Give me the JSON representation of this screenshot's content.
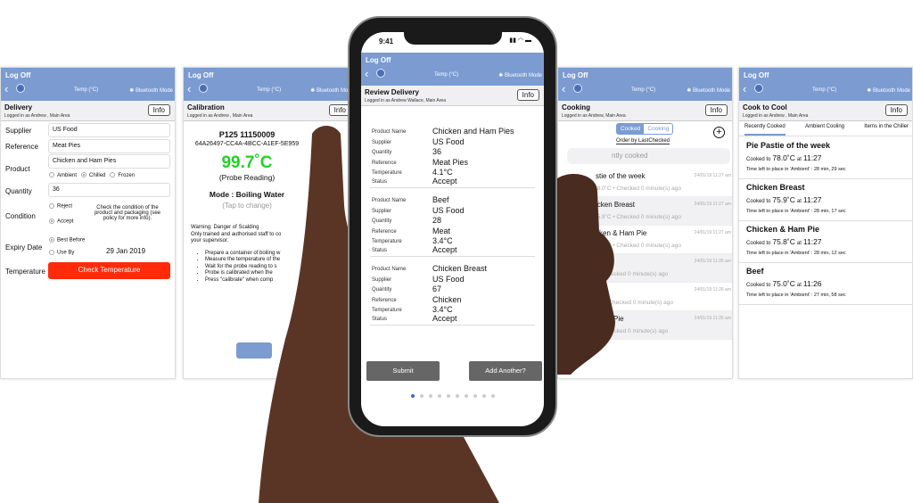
{
  "common": {
    "logoff": "Log Off",
    "back": "‹",
    "temp": "Temp (°C)",
    "bluetooth": "Bluetooth Mode",
    "bt_icon": "bluetooth-icon",
    "info": "Info"
  },
  "delivery": {
    "title": "Delivery",
    "logged": "Logged in as Andrew , Main Area",
    "supplier_label": "Supplier",
    "supplier": "US Food",
    "reference_label": "Reference",
    "reference": "Meat Pies",
    "product_label": "Product",
    "product": "Chicken and Ham Pies",
    "storage": [
      "Ambient",
      "Chilled",
      "Frozen"
    ],
    "storage_selected": "Chilled",
    "quantity_label": "Quantity",
    "quantity": "36",
    "condition_label": "Condition",
    "condition": [
      "Reject",
      "Accept"
    ],
    "condition_selected": "Accept",
    "condition_help": "Check the condition of the product and packaging (see policy for more info).",
    "expiry_label": "Expiry Date",
    "expiry": [
      "Best Before",
      "Use By"
    ],
    "expiry_selected": "Best Before",
    "expiry_date": "29 Jan 2019",
    "temperature_label": "Temperature",
    "check_temp": "Check Temperature",
    "check_color": "#ff2a0a"
  },
  "calibration": {
    "title": "Calibration",
    "logged": "Logged in as Andrew , Main Area",
    "probe": "P125 11150009",
    "uuid": "64A26497-CC4A-4BCC-A1EF-5E959",
    "reading": "99.7˚C",
    "reading_color": "#22d322",
    "reading_label": "(Probe Reading)",
    "mode": "Mode : Boiling Water",
    "tap": "(Tap to change)",
    "warning": [
      "Warning: Danger of Scalding",
      "Only trained and authorised staff to co",
      "your supervisor."
    ],
    "steps": [
      "Prepare a container of boiling w",
      "Measure the temperature of the",
      "Wait for the probe reading to s",
      "Probe is calibrated when the",
      "Press \"calibrate\" when comp"
    ]
  },
  "phone": {
    "time": "9:41",
    "title": "Review Delivery",
    "logged": "Logged in as Andrew Wallace, Main Area",
    "labels": [
      "Product Name",
      "Supplier",
      "Quantity",
      "Reference",
      "Temperature",
      "Status"
    ],
    "items": [
      [
        "Chicken and Ham Pies",
        "US Food",
        "36",
        "Meat Pies",
        "4.1°C",
        "Accept"
      ],
      [
        "Beef",
        "US Food",
        "28",
        "Meat",
        "3.4°C",
        "Accept"
      ],
      [
        "Chicken Breast",
        "US Food",
        "67",
        "Chicken",
        "3.4°C",
        "Accept"
      ]
    ],
    "submit": "Submit",
    "add_another": "Add Another?",
    "page_count": 10,
    "page_current": 1
  },
  "cooking": {
    "title": "Cooking",
    "logged": "Logged in as Andrew, Main Area",
    "seg": [
      "Cooked",
      "Cooking"
    ],
    "seg_selected": "Cooked",
    "order": "Order by LastChecked",
    "search": "ntly cooked",
    "items": [
      {
        "name": "stie of the week",
        "date": "24/01/19 11:27 am",
        "detail": "78.0˚C • Checked 0 minute(s) ago"
      },
      {
        "name": "icken Breast",
        "date": "24/01/19 11:27 am",
        "detail": "75.9˚C • Checked 0 minute(s) ago"
      },
      {
        "name": "cken & Ham Pie",
        "date": "24/01/19 11:27 am",
        "detail": "75.8˚C • Checked 0 minute(s) ago"
      },
      {
        "name": "",
        "date": "24/01/19 11:26 am",
        "detail": "C • Checked 0 minute(s) ago"
      },
      {
        "name": "",
        "date": "24/01/19 11:26 am",
        "detail": "4˚C • Checked 0 minute(s) ago"
      },
      {
        "name": "nters Pie",
        "date": "24/01/19 11:26 am",
        "detail": "C • Checked 0 minute(s) ago"
      }
    ]
  },
  "cool": {
    "title": "Cook to Cool",
    "logged": "Logged in as Andrew , Main Area",
    "tabs": [
      "Recently Cooked",
      "Ambient Cooling",
      "Items in the Chiller"
    ],
    "tab_selected": "Recently Cooked",
    "items": [
      {
        "name": "Pie Pastie of the week",
        "pre": "Cooked to",
        "temp": "78.0˚C",
        "at": "at",
        "time": "11:27",
        "left": "Time left to place in 'Ambient' : 28 min, 29 sec"
      },
      {
        "name": "Chicken Breast",
        "pre": "Cooked to",
        "temp": "75.9˚C",
        "at": "at",
        "time": "11:27",
        "left": "Time left to place in 'Ambient' : 28 min, 17 sec"
      },
      {
        "name": "Chicken & Ham Pie",
        "pre": "Cooked to",
        "temp": "75.8˚C",
        "at": "at",
        "time": "11:27",
        "left": "Time left to place in 'Ambient' : 28 min, 12 sec"
      },
      {
        "name": "Beef",
        "pre": "Cooked to",
        "temp": "75.0˚C",
        "at": "at",
        "time": "11:26",
        "left": "Time left to place in 'Ambient' : 27 min, 58 sec"
      }
    ]
  }
}
